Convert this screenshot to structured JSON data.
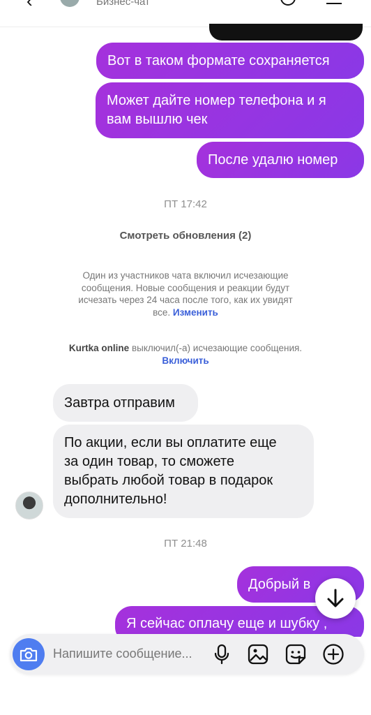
{
  "header": {
    "subtitle": "Бизнес-чат"
  },
  "messages": {
    "out1": "Вот в таком формате сохраняется",
    "out2_line1": "Может дайте номер телефона и я",
    "out2_line2": "вам вышлю чек",
    "out3": "После удалю номер",
    "in1": "Завтра отправим",
    "in2_line1": "По акции, если вы оплатите еще",
    "in2_line2": "за один товар, то сможете",
    "in2_line3": "выбрать любой товар в подарок",
    "in2_line4": "дополнительно!",
    "out4": "Добрый в",
    "out5": "Я сейчас оплачу еще и шубку ,"
  },
  "timestamps": {
    "t1": "ПТ 17:42",
    "t2": "ПТ 21:48"
  },
  "updates": {
    "label": "Смотреть обновления (2)"
  },
  "system1": {
    "line1": "Один из участников чата включил исчезающие",
    "line2": "сообщения. Новые сообщения и реакции будут",
    "line3": "исчезать через 24 часа после того, как их увидят",
    "line4": "все.",
    "link": "Изменить"
  },
  "system2": {
    "sender": "Kurtka online",
    "text": " выключил(-а) исчезающие сообщения.",
    "link": "Включить"
  },
  "composer": {
    "placeholder": "Напишите сообщение..."
  },
  "colors": {
    "outgoing": "#9a35e0",
    "incoming": "#efeff1",
    "camera": "#4f7df0",
    "link": "#3a5fd9"
  }
}
